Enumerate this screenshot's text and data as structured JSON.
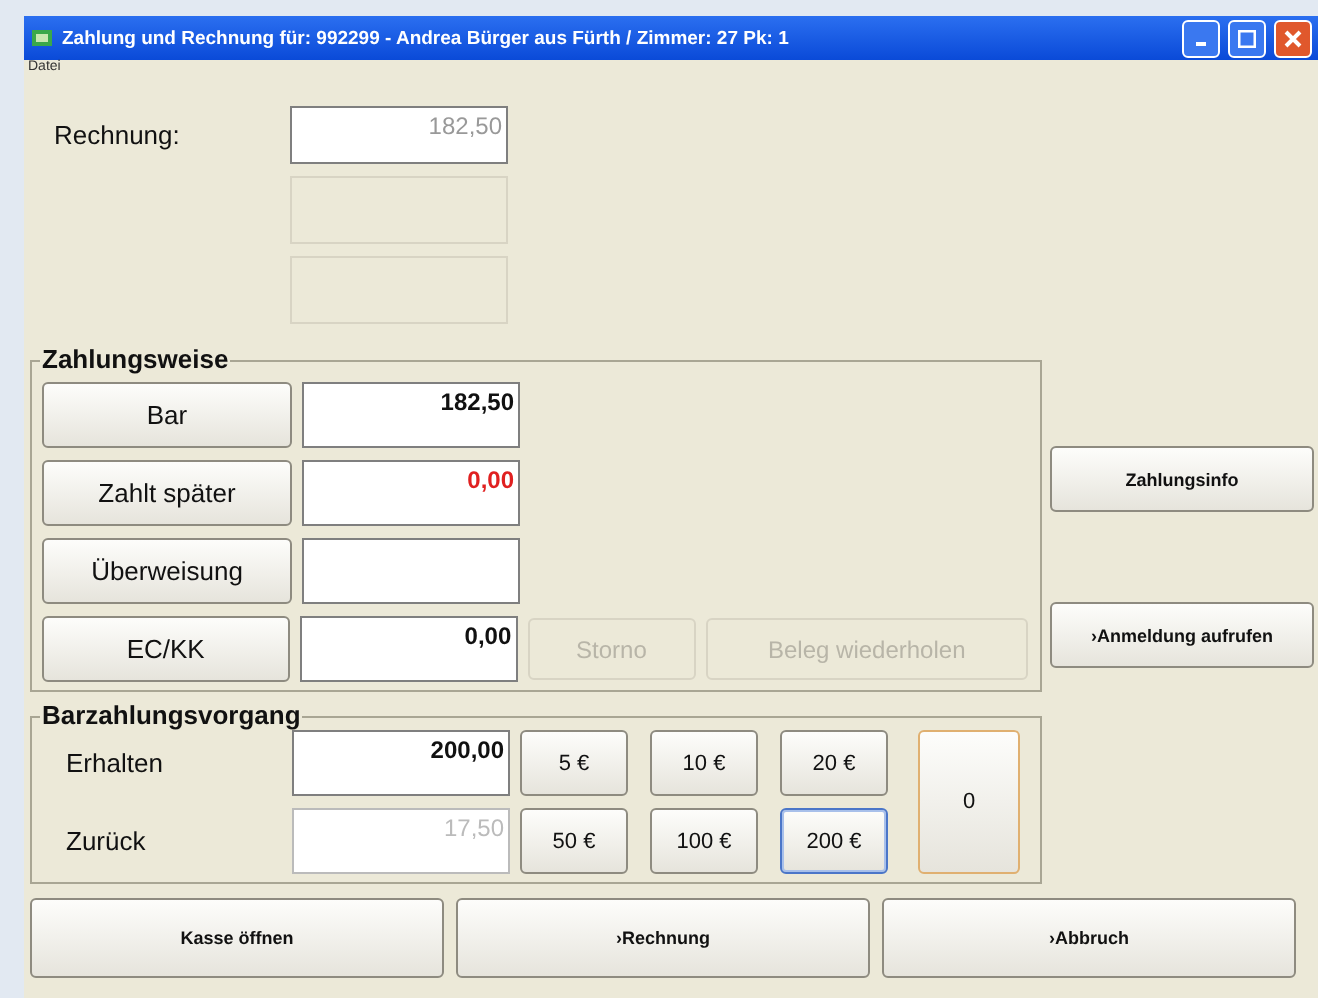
{
  "window": {
    "title": "Zahlung und Rechnung für: 992299 -  Andrea Bürger  aus Fürth / Zimmer: 27  Pk: 1"
  },
  "menu": [
    "Datei"
  ],
  "invoice": {
    "label": "Rechnung:",
    "value": "182,50"
  },
  "payment": {
    "title": "Zahlungsweise",
    "methods": [
      {
        "label": "Bar",
        "value": "182,50",
        "warning": false
      },
      {
        "label": "Zahlt später",
        "value": "0,00",
        "warning": true
      },
      {
        "label": "Überweisung"
      },
      {
        "label": "EC/KK",
        "value": "0,00",
        "warning": false
      }
    ],
    "actions": [
      {
        "label": "Storno",
        "disabled": true
      },
      {
        "label": "Beleg wiederholen",
        "disabled": true
      }
    ]
  },
  "side_buttons": [
    "Zahlungsinfo",
    "›Anmeldung aufrufen"
  ],
  "cash": {
    "title": "Barzahlungsvorgang",
    "received_label": "Erhalten",
    "received": "200,00",
    "change_label": "Zurück",
    "change": "17,50",
    "notes": [
      {
        "label": "5 €",
        "selected": false
      },
      {
        "label": "10 €",
        "selected": false
      },
      {
        "label": "20 €",
        "selected": false
      },
      {
        "label": "50 €",
        "selected": false
      },
      {
        "label": "100 €",
        "selected": false
      },
      {
        "label": "200 €",
        "selected": true
      }
    ],
    "clear": "0"
  },
  "bottom_buttons": [
    "Kasse öffnen",
    "›Rechnung",
    "›Abbruch"
  ]
}
